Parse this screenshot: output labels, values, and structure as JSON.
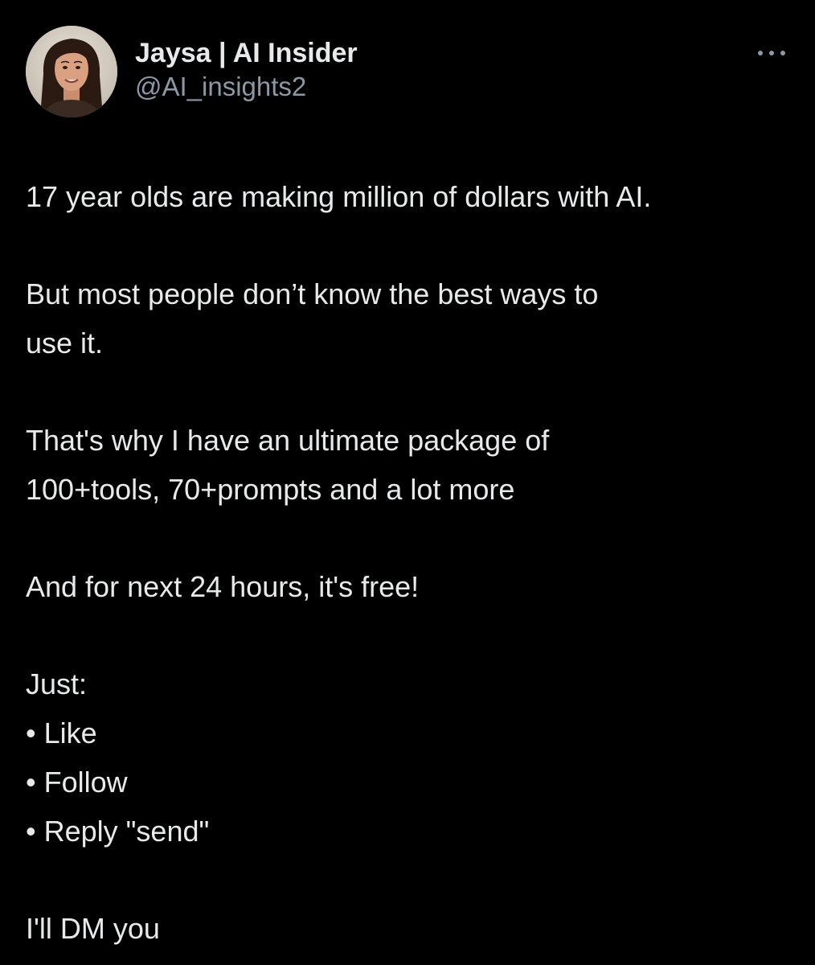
{
  "author": {
    "display_name": "Jaysa | AI Insider",
    "handle": "@AI_insights2",
    "avatar_icon": "profile-photo",
    "more_icon": "ellipsis-icon"
  },
  "tweet": {
    "p1": "17 year olds are making million of dollars with AI.",
    "p2_line1": "But most people don’t know the best ways to",
    "p2_line2": "use it.",
    "p3_line1": "That's why I have an ultimate package of",
    "p3_line2": "100+tools, 70+prompts and a lot more",
    "p4": "And for next 24 hours, it's free!",
    "just": "Just:",
    "steps": [
      "• Like",
      "• Follow",
      "• Reply \"send\""
    ],
    "closing": "I'll DM you"
  },
  "colors": {
    "background": "#000000",
    "text": "#e7e9ea",
    "secondary": "#8b98a5"
  }
}
